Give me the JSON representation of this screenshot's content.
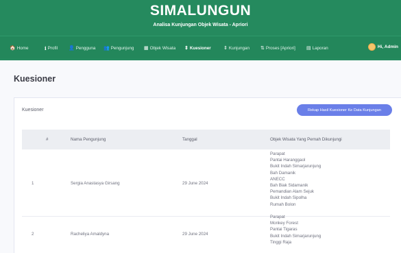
{
  "header": {
    "title": "SIMALUNGUN",
    "subtitle": "Analisa Kunjungan Objek Wisata - Apriori"
  },
  "nav": {
    "items": [
      {
        "label": "Home",
        "icon": "home-icon"
      },
      {
        "label": "Profil",
        "icon": "info-icon"
      },
      {
        "label": "Pengguna",
        "icon": "user-icon"
      },
      {
        "label": "Pengunjung",
        "icon": "users-icon"
      },
      {
        "label": "Objek Wisata",
        "icon": "map-icon"
      },
      {
        "label": "Kuesioner",
        "icon": "sort-icon",
        "active": true
      },
      {
        "label": "Kunjungan",
        "icon": "sort-icon"
      },
      {
        "label": "Proses [Apriori]",
        "icon": "sort-amount-icon"
      },
      {
        "label": "Laporan",
        "icon": "report-icon"
      }
    ],
    "user": "Hi, Admin"
  },
  "page": {
    "title": "Kuesioner"
  },
  "card": {
    "title": "Kuesioner",
    "rekap_button": "Rekap Hasil Kuesioner Ke Data Kunjungan"
  },
  "table": {
    "headers": [
      "#",
      "Nama Pengunjung",
      "Tanggal",
      "Objek Wisata Yang Pernah Dikunjungi"
    ],
    "rows": [
      {
        "no": "1",
        "nama": "Sergia Anastasya Girsang",
        "tanggal": "29 June 2024",
        "objek": [
          "Parapat",
          "Pantai Haranggaol",
          "Bukit Indah Simarjarunjung",
          "Bah Damanik",
          "ANECC",
          "Bah Biak Sidamanik",
          "Pemandian Alam Sejuk",
          "Bukit Indah Sipolha",
          "Rumah Bolon"
        ]
      },
      {
        "no": "2",
        "nama": "Racheliya Amaldyna",
        "tanggal": "29 June 2024",
        "objek": [
          "Parapat",
          "Monkey Forest",
          "Pantai Tigaras",
          "Bukit Indah Simarjarunjung",
          "Tinggi Raja"
        ]
      }
    ]
  },
  "colors": {
    "nav_green": "#258a5e",
    "button_blue": "#6a7fe8",
    "table_header_bg": "#eceef2"
  }
}
